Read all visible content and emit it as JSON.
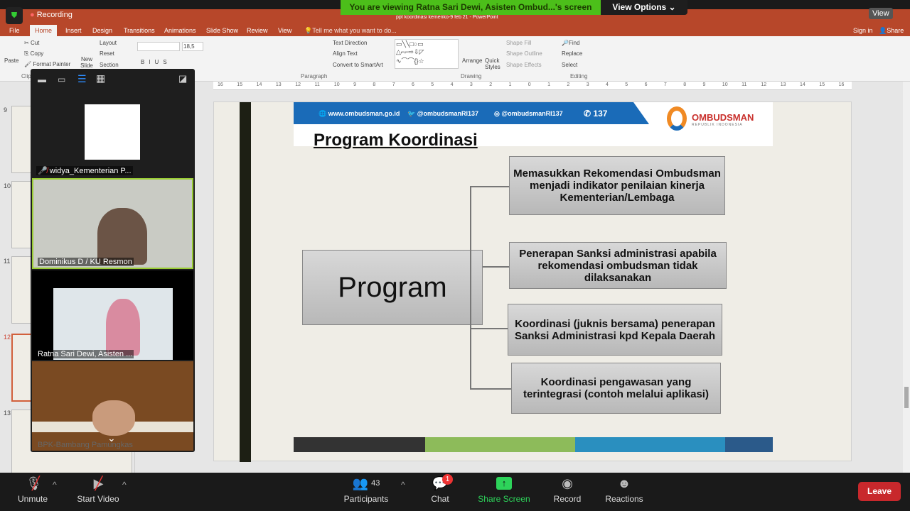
{
  "zoom": {
    "recording_label": "Recording",
    "banner": "You are viewing Ratna Sari Dewi, Asisten Ombud...'s screen",
    "view_options": "View Options",
    "view_label": "View"
  },
  "window": {
    "title": "ppt koordinasi kemenko-9 feb 21 - PowerPoint",
    "sign_in": "Sign in",
    "share": "Share"
  },
  "tabs": [
    "File",
    "Home",
    "Insert",
    "Design",
    "Transitions",
    "Animations",
    "Slide Show",
    "Review",
    "View"
  ],
  "tell_me": "Tell me what you want to do...",
  "ribbon": {
    "cut": "Cut",
    "copy": "Copy",
    "format_painter": "Format Painter",
    "paste": "Paste",
    "clipboard": "Clip",
    "new_slide": "New Slide",
    "layout": "Layout",
    "reset": "Reset",
    "section": "Section",
    "font_size": "18,5",
    "text_direction": "Text Direction",
    "align_text": "Align Text",
    "convert_smartart": "Convert to SmartArt",
    "paragraph": "Paragraph",
    "arrange": "Arrange",
    "quick_styles": "Quick Styles",
    "shape_fill": "Shape Fill",
    "shape_outline": "Shape Outline",
    "shape_effects": "Shape Effects",
    "drawing": "Drawing",
    "find": "Find",
    "replace": "Replace",
    "select": "Select",
    "editing": "Editing"
  },
  "ruler": [
    "16",
    "15",
    "14",
    "13",
    "12",
    "11",
    "10",
    "9",
    "8",
    "7",
    "6",
    "5",
    "4",
    "3",
    "2",
    "1",
    "0",
    "1",
    "2",
    "3",
    "4",
    "5",
    "6",
    "7",
    "8",
    "9",
    "10",
    "11",
    "12",
    "13",
    "14",
    "15",
    "16"
  ],
  "thumbnails": [
    "9",
    "10",
    "11",
    "12",
    "13"
  ],
  "slide": {
    "website": "www.ombudsman.go.id",
    "twitter": "@ombudsmanRI137",
    "instagram": "@ombudsmanRI137",
    "phone": "137",
    "logo_name": "OMBUDSMAN",
    "logo_sub": "REPUBLIK INDONESIA",
    "title": "Program Koordinasi",
    "program": "Program",
    "items": [
      "Memasukkan Rekomendasi Ombudsman menjadi indikator penilaian kinerja Kementerian/Lembaga",
      "Penerapan Sanksi administrasi apabila rekomendasi ombudsman tidak dilaksanakan",
      "Koordinasi (juknis bersama) penerapan Sanksi Administrasi kpd Kepala Daerah",
      "Koordinasi pengawasan yang terintegrasi (contoh melalui aplikasi)"
    ],
    "footer_colors": [
      "#333333",
      "#8dbb5a",
      "#2a8fbf",
      "#2b5a8a"
    ],
    "header_color": "#1a6bb8"
  },
  "participants_panel": [
    {
      "name": "widya_Kementerian P...",
      "muted": true
    },
    {
      "name": "Dominikus D / KU Resmon"
    },
    {
      "name": "Ratna Sari Dewi, Asisten ..."
    },
    {
      "name": "BPK-Bambang Pamungkas"
    }
  ],
  "toolbar": {
    "unmute": "Unmute",
    "start_video": "Start Video",
    "participants": "Participants",
    "participants_count": "43",
    "chat": "Chat",
    "chat_badge": "1",
    "share_screen": "Share Screen",
    "record": "Record",
    "reactions": "Reactions",
    "leave": "Leave"
  }
}
